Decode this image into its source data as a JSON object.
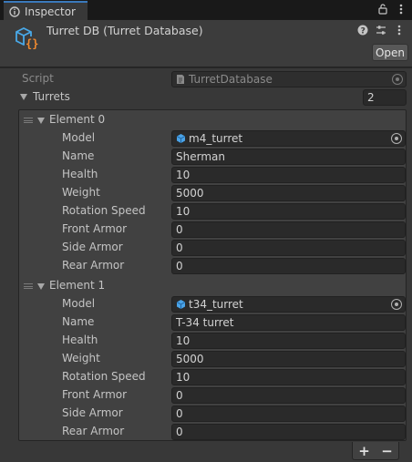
{
  "tab": {
    "label": "Inspector"
  },
  "header": {
    "title": "Turret DB (Turret Database)",
    "open_label": "Open"
  },
  "script_row": {
    "label": "Script",
    "value": "TurretDatabase"
  },
  "turrets": {
    "label": "Turrets",
    "count": "2",
    "elements": [
      {
        "label": "Element 0",
        "fields": [
          {
            "label": "Model",
            "value": "m4_turret"
          },
          {
            "label": "Name",
            "value": "Sherman"
          },
          {
            "label": "Health",
            "value": "10"
          },
          {
            "label": "Weight",
            "value": "5000"
          },
          {
            "label": "Rotation Speed",
            "value": "10"
          },
          {
            "label": "Front Armor",
            "value": "0"
          },
          {
            "label": "Side Armor",
            "value": "0"
          },
          {
            "label": "Rear Armor",
            "value": "0"
          }
        ]
      },
      {
        "label": "Element 1",
        "fields": [
          {
            "label": "Model",
            "value": "t34_turret"
          },
          {
            "label": "Name",
            "value": "T-34 turret"
          },
          {
            "label": "Health",
            "value": "10"
          },
          {
            "label": "Weight",
            "value": "5000"
          },
          {
            "label": "Rotation Speed",
            "value": "10"
          },
          {
            "label": "Front Armor",
            "value": "0"
          },
          {
            "label": "Side Armor",
            "value": "0"
          },
          {
            "label": "Rear Armor",
            "value": "0"
          }
        ]
      }
    ]
  },
  "footer": {
    "add_label": "+",
    "remove_label": "−"
  },
  "colors": {
    "accent": "#3a79bb",
    "model_icon": "#4aa3e8",
    "script_icon_orange": "#f08a30",
    "script_icon_blue": "#49a9e8"
  },
  "icons": [
    "inspector-icon",
    "lock-icon",
    "kebab-menu-icon",
    "script-asset-icon",
    "help-icon",
    "preset-icon",
    "object-picker-icon",
    "model-prefab-icon",
    "script-file-icon"
  ]
}
